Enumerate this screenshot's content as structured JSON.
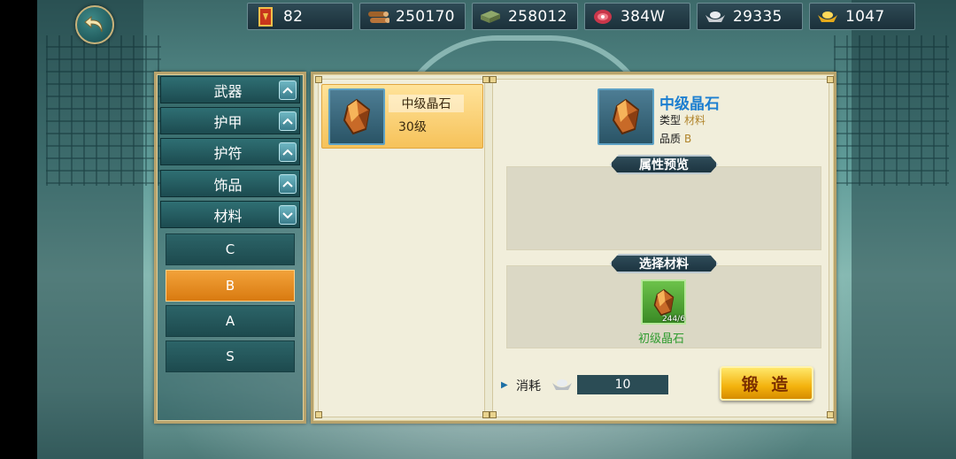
{
  "resources": [
    {
      "icon": "token-icon",
      "value": "82"
    },
    {
      "icon": "wood-icon",
      "value": "250170"
    },
    {
      "icon": "cloth-icon",
      "value": "258012"
    },
    {
      "icon": "meat-icon",
      "value": "384W"
    },
    {
      "icon": "silver-ingot-icon",
      "value": "29335"
    },
    {
      "icon": "gold-ingot-icon",
      "value": "1047"
    }
  ],
  "categories": [
    {
      "label": "武器",
      "state": "collapsed"
    },
    {
      "label": "护甲",
      "state": "collapsed"
    },
    {
      "label": "护符",
      "state": "collapsed"
    },
    {
      "label": "饰品",
      "state": "collapsed"
    },
    {
      "label": "材料",
      "state": "expanded"
    }
  ],
  "subcategories": [
    {
      "label": "C",
      "active": false
    },
    {
      "label": "B",
      "active": true
    },
    {
      "label": "A",
      "active": false
    },
    {
      "label": "S",
      "active": false
    }
  ],
  "item_list": [
    {
      "name": "中级晶石",
      "level": "30级"
    }
  ],
  "detail": {
    "name": "中级晶石",
    "type_label": "类型",
    "type_value": "材料",
    "quality_label": "品质",
    "quality_value": "B",
    "attr_preview_title": "属性预览",
    "select_material_title": "选择材料"
  },
  "material": {
    "name": "初级晶石",
    "count": "244/6"
  },
  "cost": {
    "label": "消耗",
    "value": "10"
  },
  "forge_label": "锻 造",
  "colors": {
    "accent_orange": "#f2a23a",
    "name_blue": "#1d7fd0",
    "material_green": "#2f9b2f",
    "forge_gold": "#f3b20e"
  }
}
